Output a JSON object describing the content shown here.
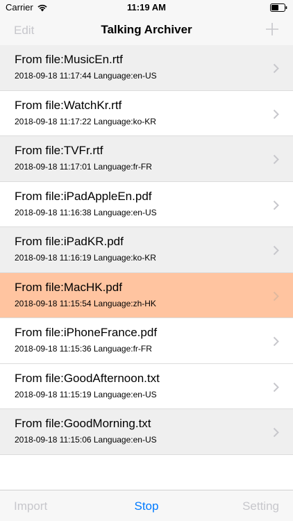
{
  "status_bar": {
    "carrier": "Carrier",
    "time": "11:19 AM"
  },
  "nav": {
    "left_label": "Edit",
    "title": "Talking Archiver",
    "right_icon": "plus-icon"
  },
  "items": [
    {
      "title": "From file:MusicEn.rtf",
      "subtitle": "2018-09-18 11:17:44 Language:en-US"
    },
    {
      "title": "From file:WatchKr.rtf",
      "subtitle": "2018-09-18 11:17:22 Language:ko-KR"
    },
    {
      "title": "From file:TVFr.rtf",
      "subtitle": "2018-09-18 11:17:01 Language:fr-FR"
    },
    {
      "title": "From file:iPadAppleEn.pdf",
      "subtitle": "2018-09-18 11:16:38 Language:en-US"
    },
    {
      "title": "From file:iPadKR.pdf",
      "subtitle": "2018-09-18 11:16:19 Language:ko-KR"
    },
    {
      "title": "From file:MacHK.pdf",
      "subtitle": "2018-09-18 11:15:54 Language:zh-HK"
    },
    {
      "title": "From file:iPhoneFrance.pdf",
      "subtitle": "2018-09-18 11:15:36 Language:fr-FR"
    },
    {
      "title": "From file:GoodAfternoon.txt",
      "subtitle": "2018-09-18 11:15:19 Language:en-US"
    },
    {
      "title": "From file:GoodMorning.txt",
      "subtitle": "2018-09-18 11:15:06 Language:en-US"
    }
  ],
  "colors": {
    "selected_row": "#ffc4a0",
    "accent": "#007aff",
    "disabled": "#c7c7cc"
  },
  "tab_bar": {
    "left_label": "Import",
    "center_label": "Stop",
    "right_label": "Setting"
  }
}
